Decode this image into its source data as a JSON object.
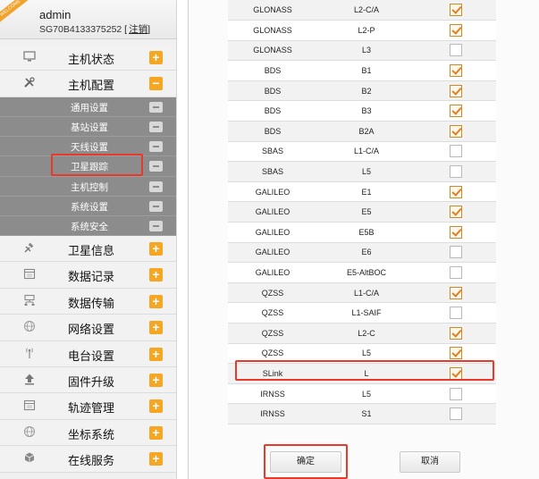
{
  "header": {
    "ribbon": "WELCOME",
    "user": "admin",
    "serial": "SG70B4133375252",
    "logout": "注销",
    "bracket_open": "[",
    "bracket_close": "]"
  },
  "menu": {
    "top": [
      {
        "label": "主机状态",
        "icon": "monitor-icon",
        "toggle": "+"
      },
      {
        "label": "主机配置",
        "icon": "tools-icon",
        "toggle": "−"
      }
    ],
    "submenu": [
      {
        "label": "通用设置"
      },
      {
        "label": "基站设置"
      },
      {
        "label": "天线设置"
      },
      {
        "label": "卫星跟踪"
      },
      {
        "label": "主机控制"
      },
      {
        "label": "系统设置"
      },
      {
        "label": "系统安全"
      }
    ],
    "bottom": [
      {
        "label": "卫星信息",
        "icon": "satellite-icon",
        "toggle": "+"
      },
      {
        "label": "数据记录",
        "icon": "calendar-icon",
        "toggle": "+"
      },
      {
        "label": "数据传输",
        "icon": "network-icon",
        "toggle": "+"
      },
      {
        "label": "网络设置",
        "icon": "globe-icon",
        "toggle": "+"
      },
      {
        "label": "电台设置",
        "icon": "radio-icon",
        "toggle": "+"
      },
      {
        "label": "固件升级",
        "icon": "upload-icon",
        "toggle": "+"
      },
      {
        "label": "轨迹管理",
        "icon": "calendar-icon",
        "toggle": "+"
      },
      {
        "label": "坐标系统",
        "icon": "globe-icon",
        "toggle": "+"
      },
      {
        "label": "在线服务",
        "icon": "cube-icon",
        "toggle": "+"
      }
    ]
  },
  "table": {
    "rows": [
      {
        "system": "GLONASS",
        "signal": "L2-C/A",
        "checked": true
      },
      {
        "system": "GLONASS",
        "signal": "L2-P",
        "checked": true
      },
      {
        "system": "GLONASS",
        "signal": "L3",
        "checked": false
      },
      {
        "system": "BDS",
        "signal": "B1",
        "checked": true
      },
      {
        "system": "BDS",
        "signal": "B2",
        "checked": true
      },
      {
        "system": "BDS",
        "signal": "B3",
        "checked": true
      },
      {
        "system": "BDS",
        "signal": "B2A",
        "checked": true
      },
      {
        "system": "SBAS",
        "signal": "L1-C/A",
        "checked": false
      },
      {
        "system": "SBAS",
        "signal": "L5",
        "checked": false
      },
      {
        "system": "GALILEO",
        "signal": "E1",
        "checked": true
      },
      {
        "system": "GALILEO",
        "signal": "E5",
        "checked": true
      },
      {
        "system": "GALILEO",
        "signal": "E5B",
        "checked": true
      },
      {
        "system": "GALILEO",
        "signal": "E6",
        "checked": false
      },
      {
        "system": "GALILEO",
        "signal": "E5-AltBOC",
        "checked": false
      },
      {
        "system": "QZSS",
        "signal": "L1-C/A",
        "checked": true
      },
      {
        "system": "QZSS",
        "signal": "L1-SAIF",
        "checked": false
      },
      {
        "system": "QZSS",
        "signal": "L2-C",
        "checked": true
      },
      {
        "system": "QZSS",
        "signal": "L5",
        "checked": true
      },
      {
        "system": "SLink",
        "signal": "L",
        "checked": true
      },
      {
        "system": "IRNSS",
        "signal": "L5",
        "checked": false
      },
      {
        "system": "IRNSS",
        "signal": "S1",
        "checked": false
      }
    ]
  },
  "buttons": {
    "confirm": "确定",
    "cancel": "取消"
  },
  "colors": {
    "accent_orange": "#f5a623",
    "highlight_red": "#e8392b",
    "submenu_bg": "#8c8c8c"
  }
}
